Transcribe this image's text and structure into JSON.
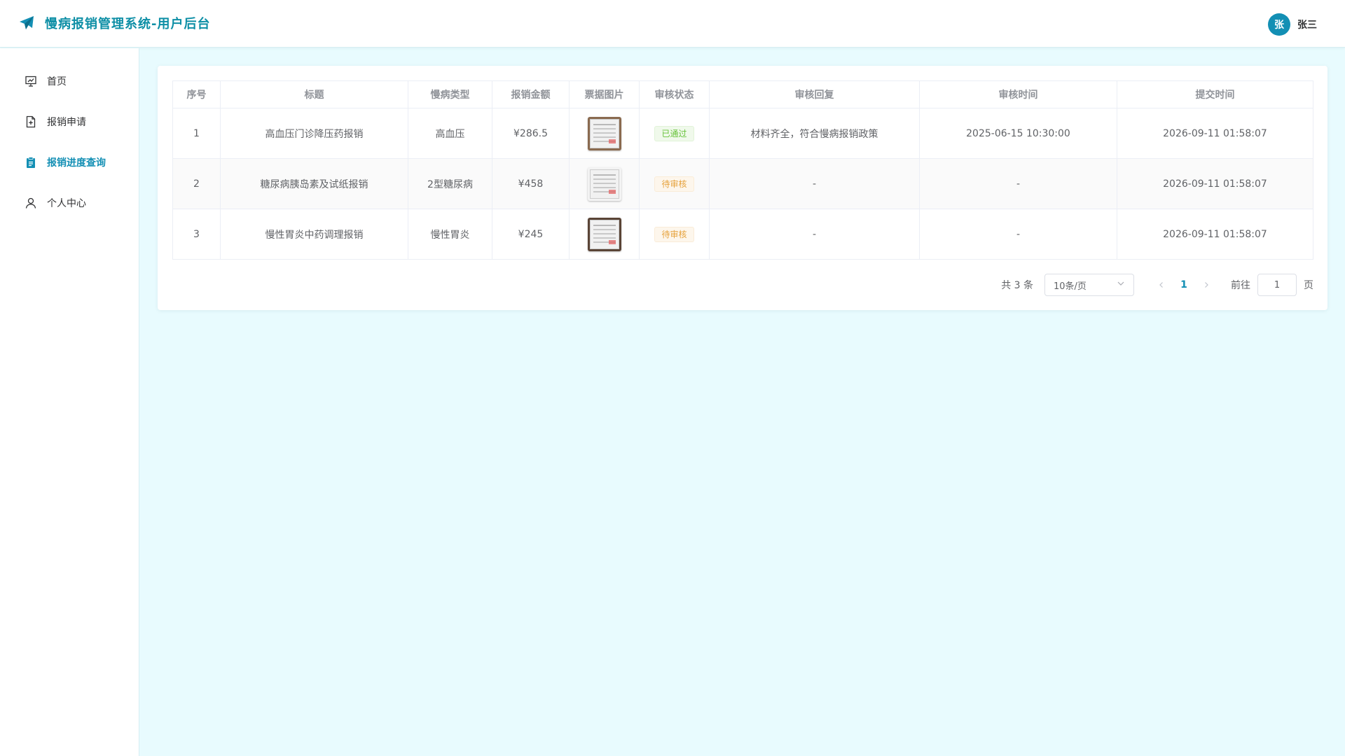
{
  "header": {
    "title": "慢病报销管理系统-用户后台",
    "brand_icon": "paper-plane-icon",
    "user": {
      "avatar_text": "张",
      "name": "张三"
    }
  },
  "sidebar": {
    "items": [
      {
        "label": "首页",
        "icon": "presentation-chart-icon",
        "active": false
      },
      {
        "label": "报销申请",
        "icon": "document-add-icon",
        "active": false
      },
      {
        "label": "报销进度查询",
        "icon": "clipboard-icon",
        "active": true
      },
      {
        "label": "个人中心",
        "icon": "user-icon",
        "active": false
      }
    ]
  },
  "table": {
    "columns": [
      "序号",
      "标题",
      "慢病类型",
      "报销金额",
      "票据图片",
      "审核状态",
      "审核回复",
      "审核时间",
      "提交时间"
    ],
    "rows": [
      {
        "index": "1",
        "title": "高血压门诊降压药报销",
        "disease": "高血压",
        "amount": "¥286.5",
        "status": "已通过",
        "status_type": "success",
        "reply": "材料齐全，符合慢病报销政策",
        "review_time": "2025-06-15 10:30:00",
        "submit_time": "2026-09-11 01:58:07"
      },
      {
        "index": "2",
        "title": "糖尿病胰岛素及试纸报销",
        "disease": "2型糖尿病",
        "amount": "¥458",
        "status": "待审核",
        "status_type": "warning",
        "reply": "-",
        "review_time": "-",
        "submit_time": "2026-09-11 01:58:07"
      },
      {
        "index": "3",
        "title": "慢性胃炎中药调理报销",
        "disease": "慢性胃炎",
        "amount": "¥245",
        "status": "待审核",
        "status_type": "warning",
        "reply": "-",
        "review_time": "-",
        "submit_time": "2026-09-11 01:58:07"
      }
    ]
  },
  "pagination": {
    "total_text": "共 3 条",
    "page_size": "10条/页",
    "current_page": "1",
    "goto_label": "前往",
    "goto_value": "1",
    "page_suffix": "页"
  },
  "colors": {
    "accent": "#138fb4",
    "brand_text": "#0e8fa6",
    "background": "#e8fbfe"
  }
}
